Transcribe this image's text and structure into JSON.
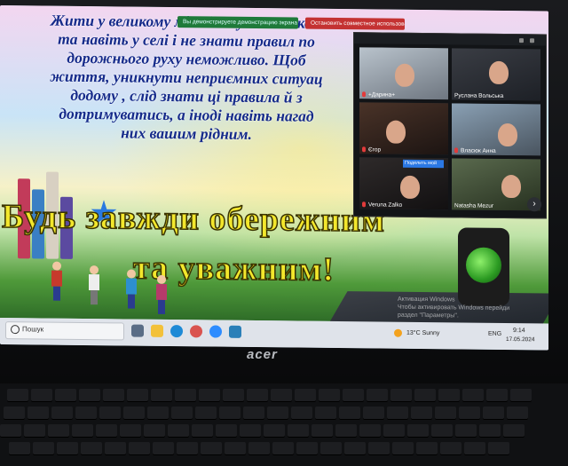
{
  "slide": {
    "paragraph": "Жити у великому місті чи у маленьком\nта навіть у селі і не знати правил по\nдорожнього руху неможливо. Щоб\nжиття, уникнути неприємних ситуац\nдодому , слід знати ці правила й з\nдотримуватись, а іноді навіть нагад\nних вашим рідним.",
    "title_line1": "Будь завжди обережним",
    "title_line2": "та уважним!"
  },
  "zoom": {
    "banners": {
      "demo": "Вы демонстрируете демонстрацию экрана",
      "stop": "Остановить совместное использование"
    },
    "tooltip": "Поделить мой",
    "participants": [
      {
        "name": "+Дарина+"
      },
      {
        "name": "Руслана Вольська"
      },
      {
        "name": "Єгор"
      },
      {
        "name": "Власюк Анна"
      },
      {
        "name": "Veruna Zalko"
      },
      {
        "name": "Natasha Mezur"
      }
    ]
  },
  "watermark": {
    "line1": "Активация Windows",
    "line2": "Чтобы активировать Windows перейди",
    "line3": "раздел \"Параметры\"."
  },
  "taskbar": {
    "search_placeholder": "Пошук",
    "weather": "13°C  Sunny",
    "language": "ENG",
    "time": "9:14",
    "date": "17.05.2024"
  },
  "brand": "acer",
  "icons": {
    "start": "windows-start-icon",
    "search": "search-icon",
    "weather": "sun-icon"
  }
}
